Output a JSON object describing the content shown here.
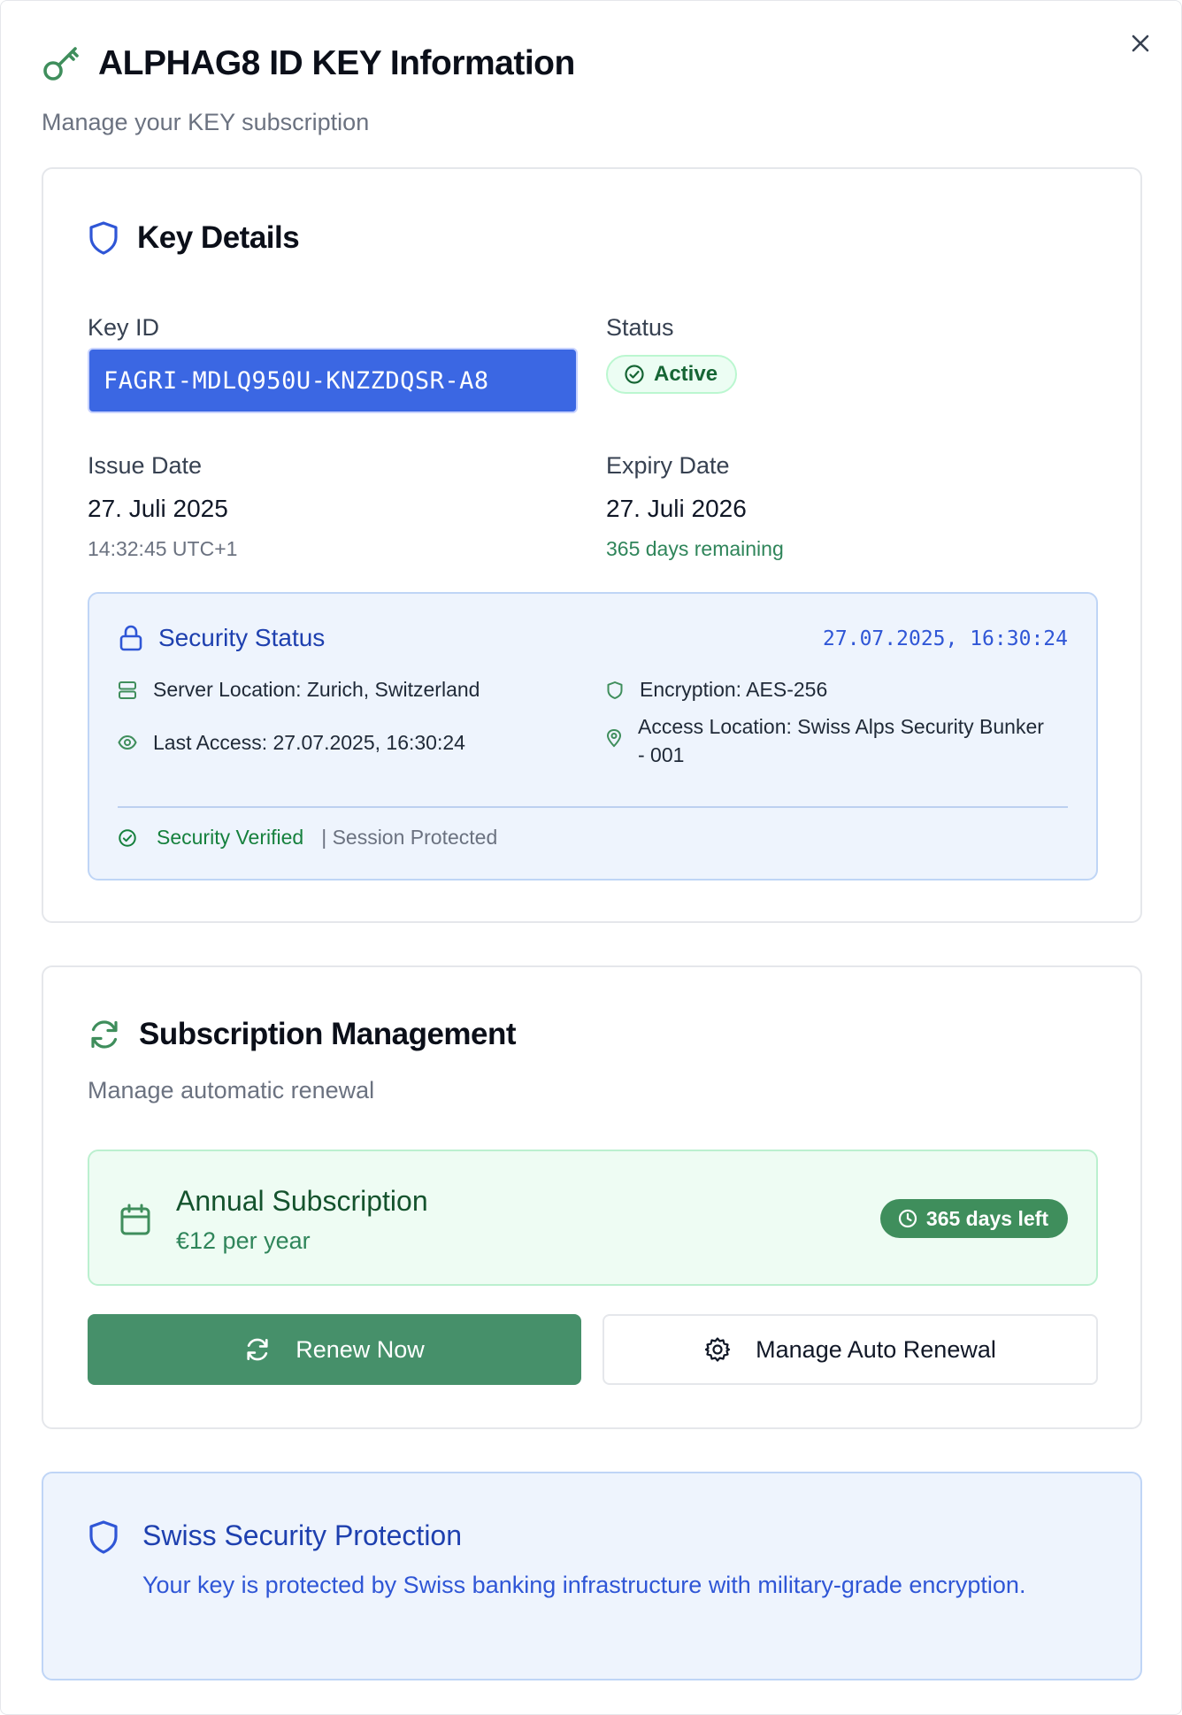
{
  "dialog": {
    "title": "ALPHAG8 ID KEY Information",
    "subtitle": "Manage your KEY subscription",
    "close_icon": "close-icon",
    "title_icon": "key-icon"
  },
  "key_details": {
    "title": "Key Details",
    "icon": "shield-icon",
    "key_id_label": "Key ID",
    "key_id_value": "FAGRI-MDLQ950U-KNZZDQSR-A8",
    "status_label": "Status",
    "status_value": "Active",
    "issue_date_label": "Issue Date",
    "issue_date_value": "27. Juli 2025",
    "issue_time_value": "14:32:45 UTC+1",
    "expiry_date_label": "Expiry Date",
    "expiry_date_value": "27. Juli 2026",
    "days_remaining": "365 days remaining"
  },
  "security_status": {
    "title": "Security Status",
    "timestamp": "27.07.2025, 16:30:24",
    "server_location": "Server Location: Zurich, Switzerland",
    "encryption": "Encryption: AES-256",
    "last_access": "Last Access: 27.07.2025, 16:30:24",
    "access_location": "Access Location: Swiss Alps Security Bunker - 001",
    "verified": "Security Verified",
    "protected": "| Session Protected"
  },
  "subscription": {
    "title": "Subscription Management",
    "icon": "refresh-icon",
    "description": "Manage automatic renewal",
    "plan_name": "Annual Subscription",
    "plan_price": "€12 per year",
    "days_left": "365 days left",
    "renew_button": "Renew Now",
    "manage_button": "Manage Auto Renewal"
  },
  "swiss": {
    "title": "Swiss Security Protection",
    "text": "Your key is protected by Swiss banking infrastructure with military-grade encryption."
  },
  "colors": {
    "green_accent": "#46906a",
    "blue_accent": "#3b67e3",
    "security_bg": "#eef4fd",
    "plan_bg": "#eefcf3"
  }
}
